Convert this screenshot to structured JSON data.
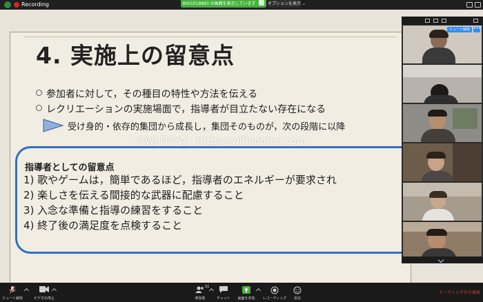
{
  "top_bar": {
    "recording_label": "Recording",
    "share_banner": "8001018883 の画面を表示しています",
    "view_options_label": "オプションを表示 ⌄"
  },
  "slide": {
    "title": "4. 実施上の留意点",
    "bullets": [
      "参加者に対して，その種目の特性や方法を伝える",
      "レクリエーションの実施場面で，指導者が目立たない存在になる"
    ],
    "sub_bullet": "受け身的・依存的集団から成長し，集団そのものが，次の段階に以降",
    "watermark": "©Wi-Fiの森　https://wifinomori.com",
    "notes_title": "指導者としての留意点",
    "notes": [
      "1) 歌やゲームは，簡単であるほど，指導者のエネルギーが要求され",
      "2) 楽しさを伝える間接的な武器に配慮すること",
      "3) 入念な準備と指導の練習をすること",
      "4) 終了後の満足度を点検すること"
    ]
  },
  "participants_panel": {
    "mute_badge": "ミュート解除",
    "more_label": "•••",
    "tiles": 6
  },
  "toolbar": {
    "mute_label": "ミュート解除",
    "video_label": "ビデオの停止",
    "participants_label": "参加者",
    "participants_count": "11",
    "chat_label": "チャット",
    "share_label": "画面を共有",
    "record_label": "レコーディング",
    "reactions_label": "反応",
    "leave_label": "ミーティングから退出"
  },
  "colors": {
    "share_green": "#45b23c",
    "accent_blue": "#2d8cff",
    "leave_red": "#e0453a",
    "notes_border": "#2f6fc4"
  },
  "icons": [
    "info-icon",
    "record-icon",
    "mic-icon",
    "camera-icon",
    "participants-icon",
    "chat-icon",
    "share-screen-icon",
    "record-button-icon",
    "reaction-icon",
    "chevron-down-icon"
  ]
}
